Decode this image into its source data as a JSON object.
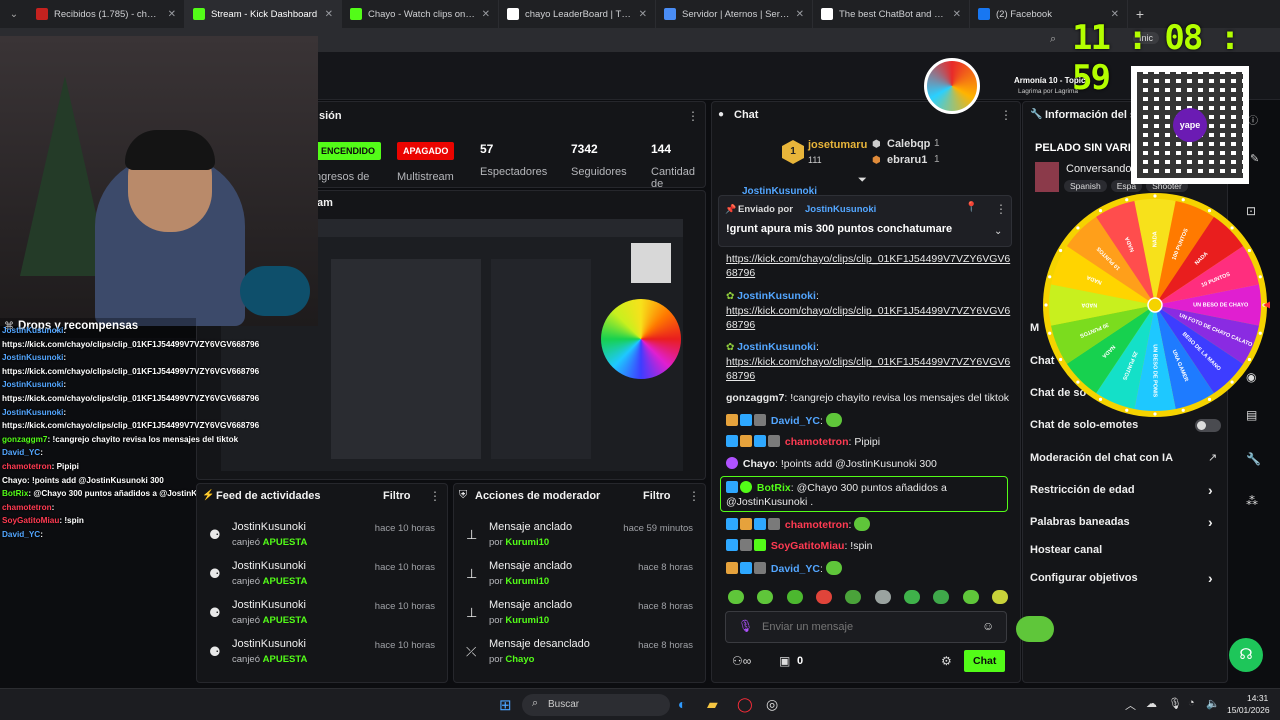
{
  "browser": {
    "tabs": [
      {
        "title": "Recibidos (1.785) - chayo.tube.18...",
        "color": "#c5221f",
        "active": false
      },
      {
        "title": "Stream - Kick Dashboard",
        "color": "#53fc18",
        "active": true
      },
      {
        "title": "Chayo - Watch clips on Kick",
        "color": "#53fc18",
        "active": false
      },
      {
        "title": "chayo LeaderBoard | The best Cha...",
        "color": "#ffffff",
        "active": false
      },
      {
        "title": "Servidor | Aternos | Servidor de M...",
        "color": "#4a8df5",
        "active": false
      },
      {
        "title": "The best ChatBot and Widgets fo...",
        "color": "#ffffff",
        "active": false
      },
      {
        "title": "(2) Facebook",
        "color": "#1877f2",
        "active": false
      }
    ],
    "new_tab": "+",
    "signin": "Inic"
  },
  "clock": {
    "time": "11 : 08 : 59"
  },
  "music": {
    "title": "Armonía 10 - Topic",
    "subtitle": "Lagrima por Lagrima"
  },
  "webcam_overlay": {
    "title": "Drops y recompensas"
  },
  "overlay_chat": [
    {
      "user": "JostinKusunoki",
      "text": ":"
    },
    {
      "user": "",
      "text": "https://kick.com/chayo/clips/clip_01KF1J54499V7VZY6VGV668796"
    },
    {
      "user": "JostinKusunoki",
      "text": ":"
    },
    {
      "user": "",
      "text": "https://kick.com/chayo/clips/clip_01KF1J54499V7VZY6VGV668796"
    },
    {
      "user": "JostinKusunoki",
      "text": ":"
    },
    {
      "user": "",
      "text": "https://kick.com/chayo/clips/clip_01KF1J54499V7VZY6VGV668796"
    },
    {
      "user": "JostinKusunoki",
      "text": ":"
    },
    {
      "user": "",
      "text": "https://kick.com/chayo/clips/clip_01KF1J54499V7VZY6VGV668796"
    },
    {
      "user": "gonzaggm7",
      "text": ": !cangrejo chayito revisa los mensajes del tiktok"
    },
    {
      "user": "David_YC",
      "text": ":"
    },
    {
      "user": "chamotetron",
      "text": ": Pipipi"
    },
    {
      "user": "Chayo",
      "text": ": !points add @JostinKusunoki 300"
    },
    {
      "user": "BotRix",
      "text": ": @Chayo 300 puntos añadidos a @JostinKusunoki ."
    },
    {
      "user": "chamotetron",
      "text": ":"
    },
    {
      "user": "SoyGatitoMiau",
      "text": ": !spin"
    },
    {
      "user": "David_YC",
      "text": ":"
    }
  ],
  "session": {
    "title": "sión",
    "on_label": "ENCENDIDO",
    "off_label": "APAGADO",
    "ingresos_label": "ngresos de",
    "multistream_label": "Multistream",
    "viewers_value": "57",
    "viewers_label": "Espectadores",
    "followers_value": "7342",
    "followers_label": "Seguidores",
    "subs_value": "144",
    "subs_label": "Cantidad de"
  },
  "preview": {
    "title": "am"
  },
  "activity": {
    "title": "Feed de actividades",
    "filter": "Filtro",
    "items": [
      {
        "user": "JostinKusunoki",
        "action": "canjeó",
        "reward": "APUESTA",
        "time": "hace 10 horas"
      },
      {
        "user": "JostinKusunoki",
        "action": "canjeó",
        "reward": "APUESTA",
        "time": "hace 10 horas"
      },
      {
        "user": "JostinKusunoki",
        "action": "canjeó",
        "reward": "APUESTA",
        "time": "hace 10 horas"
      },
      {
        "user": "JostinKusunoki",
        "action": "canjeó",
        "reward": "APUESTA",
        "time": "hace 10 horas"
      }
    ]
  },
  "modactions": {
    "title": "Acciones de moderador",
    "filter": "Filtro",
    "items": [
      {
        "action": "Mensaje anclado",
        "by": "por",
        "mod": "Kurumi10",
        "time": "hace 59 minutos"
      },
      {
        "action": "Mensaje anclado",
        "by": "por",
        "mod": "Kurumi10",
        "time": "hace 8 horas"
      },
      {
        "action": "Mensaje anclado",
        "by": "por",
        "mod": "Kurumi10",
        "time": "hace 8 horas"
      },
      {
        "action": "Mensaje desanclado",
        "by": "por",
        "mod": "Chayo",
        "time": "hace 8 horas"
      }
    ]
  },
  "chat": {
    "title": "Chat",
    "leaders": {
      "first": "josetumaru",
      "first_count": "111",
      "second": "Calebqp",
      "second_count": "1",
      "third": "ebraru1",
      "third_count": "1"
    },
    "pinned": {
      "label": "Enviado por",
      "user": "JostinKusunoki",
      "text": "!grunt apura mis 300 puntos conchatumare"
    },
    "partial_user": "JostinKusunoki",
    "messages": [
      {
        "user": "",
        "text": "https://kick.com/chayo/clips/clip_01KF1J54499V7VZY6VGV6",
        "text2": "68796"
      },
      {
        "user": "JostinKusunoki",
        "text": "https://kick.com/chayo/clips/clip_01KF1J54499V7VZY6VGV6",
        "text2": "68796"
      },
      {
        "user": "JostinKusunoki",
        "text": "https://kick.com/chayo/clips/clip_01KF1J54499V7VZY6VGV6",
        "text2": "68796"
      }
    ],
    "m_gonza_user": "gonzaggm7",
    "m_gonza_text": "!cangrejo chayito revisa los mensajes del tiktok",
    "m_david1_user": "David_YC",
    "m_chamo1_user": "chamotetron",
    "m_chamo1_text": "Pipipi",
    "m_chayo_user": "Chayo",
    "m_chayo_text": "!points add @JostinKusunoki 300",
    "m_botrix_user": "BotRix",
    "m_botrix_text": "@Chayo 300 puntos añadidos a",
    "m_botrix_text2": "@JostinKusunoki .",
    "m_chamo2_user": "chamotetron",
    "m_soy_user": "SoyGatitoMiau",
    "m_soy_text": "!spin",
    "m_david2_user": "David_YC",
    "input_placeholder": "Enviar un mensaje",
    "points": "0",
    "send_label": "Chat"
  },
  "info": {
    "title": "Información del s",
    "stream_title": "PELADO SIN VARIE",
    "category": "Conversando",
    "tags": [
      "Spanish",
      "Espa",
      "Shooter"
    ]
  },
  "settings": [
    {
      "label": "M",
      "arrow": false
    },
    {
      "label": "Chat",
      "arrow": false
    },
    {
      "label": "Chat de so",
      "arrow": false
    },
    {
      "label": "Chat de solo-emotes",
      "arrow": false
    },
    {
      "label": "Moderación del chat con IA",
      "arrow": false
    },
    {
      "label": "Restricción de edad",
      "arrow": true
    },
    {
      "label": "Palabras baneadas",
      "arrow": true
    },
    {
      "label": "Hostear canal",
      "arrow": false
    },
    {
      "label": "Configurar objetivos",
      "arrow": true
    }
  ],
  "wheel": {
    "segments": [
      "NADA",
      "100 PUNTOS",
      "NADA",
      "10 PUNTOS",
      "UN BESO DE CHAYO",
      "UN FOTO DE CHAYO CALATO",
      "BESO DE LA MANO",
      "UNA GAMER",
      "UN BESO DE PONIS",
      "25 PUNTOS",
      "NADA",
      "30 PUNTOS",
      "NADA",
      "NADA",
      "10 PUNTOS",
      "NADA"
    ],
    "colors": [
      "#f7e11b",
      "#ff7a00",
      "#e91e1e",
      "#ff2e7e",
      "#e01fd0",
      "#8a2be2",
      "#3d3dff",
      "#1e7bff",
      "#1ec8ff",
      "#14e0c8",
      "#17d14f",
      "#7bdc1e",
      "#c8f01e",
      "#ffd400",
      "#ff9f1a",
      "#ff4d4d"
    ]
  },
  "qr": {
    "label": "yape"
  },
  "taskbar": {
    "search": "Buscar",
    "time": "14:31",
    "date": "15/01/2026"
  }
}
